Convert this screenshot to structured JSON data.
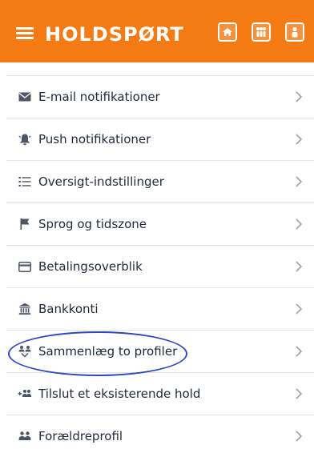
{
  "header": {
    "brand": "HOLDSPØRT",
    "background_color": "#f47a14",
    "icons": [
      "home-icon",
      "team-icon",
      "profile-icon"
    ]
  },
  "menu": {
    "items": [
      {
        "label": "E-mail notifikationer",
        "icon": "envelope-icon"
      },
      {
        "label": "Push notifikationer",
        "icon": "bell-icon"
      },
      {
        "label": "Oversigt-indstillinger",
        "icon": "list-icon"
      },
      {
        "label": "Sprog og tidszone",
        "icon": "flag-icon"
      },
      {
        "label": "Betalingsoverblik",
        "icon": "card-icon"
      },
      {
        "label": "Bankkonti",
        "icon": "bank-icon"
      },
      {
        "label": "Sammenlæg to profiler",
        "icon": "merge-profiles-icon",
        "highlighted": true
      },
      {
        "label": "Tilslut et eksisterende hold",
        "icon": "add-group-icon"
      },
      {
        "label": "Forældreprofil",
        "icon": "group-icon"
      }
    ]
  },
  "annotation": {
    "color": "#2d47c8"
  }
}
